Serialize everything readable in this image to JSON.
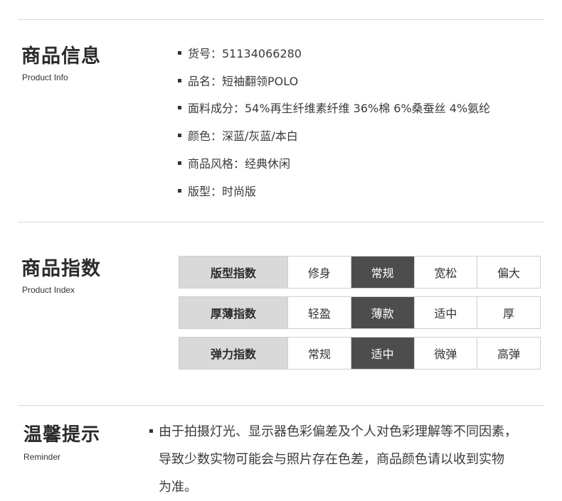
{
  "product_info": {
    "title": "商品信息",
    "subtitle": "Product Info",
    "items": [
      "货号：51134066280",
      "品名：短袖翻领POLO",
      "面料成分：54%再生纤维素纤维 36%棉 6%桑蚕丝 4%氨纶",
      "颜色：深蓝/灰蓝/本白",
      "商品风格：经典休闲",
      "版型：时尚版"
    ]
  },
  "product_index": {
    "title": "商品指数",
    "subtitle": "Product Index",
    "rows": [
      {
        "label": "版型指数",
        "options": [
          "修身",
          "常规",
          "宽松",
          "偏大"
        ],
        "selected": "常规"
      },
      {
        "label": "厚薄指数",
        "options": [
          "轻盈",
          "薄款",
          "适中",
          "厚"
        ],
        "selected": "薄款"
      },
      {
        "label": "弹力指数",
        "options": [
          "常规",
          "适中",
          "微弹",
          "高弹"
        ],
        "selected": "适中"
      }
    ]
  },
  "reminder": {
    "title": "温馨提示",
    "subtitle": "Reminder",
    "lines": [
      "由于拍摄灯光、显示器色彩偏差及个人对色彩理解等不同因素，",
      "导致少数实物可能会与照片存在色差，商品颜色请以收到实物",
      "为准。"
    ]
  },
  "colors": {
    "selected_bg": "#4d4d4d",
    "label_bg": "#d9d9d9",
    "divider": "#d9d9d9"
  }
}
